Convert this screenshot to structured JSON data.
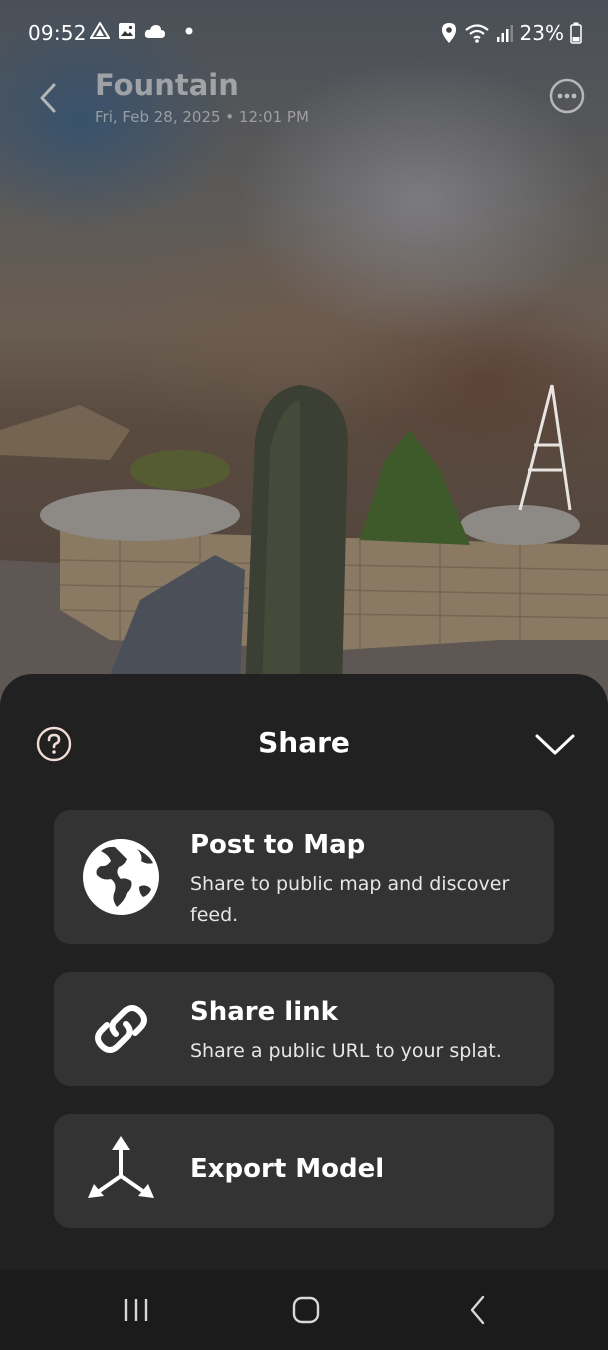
{
  "status_bar": {
    "time": "09:52",
    "left_icons": [
      "drive-icon",
      "image-icon",
      "cloud-icon",
      "dot-icon"
    ],
    "right_icons": [
      "location-icon",
      "wifi-icon",
      "signal-icon",
      "battery-icon"
    ],
    "battery": "23%"
  },
  "header": {
    "title": "Fountain",
    "subtitle": "Fri, Feb 28, 2025 • 12:01 PM"
  },
  "share_sheet": {
    "title": "Share",
    "options": [
      {
        "icon": "globe-icon",
        "title": "Post to Map",
        "description": "Share to public map and discover feed."
      },
      {
        "icon": "link-icon",
        "title": "Share link",
        "description": "Share a public URL to your splat."
      },
      {
        "icon": "export-model-icon",
        "title": "Export Model"
      }
    ]
  },
  "colors": {
    "sheet_background": "#212121",
    "option_background": "#333333",
    "text_primary": "#ffffff"
  }
}
